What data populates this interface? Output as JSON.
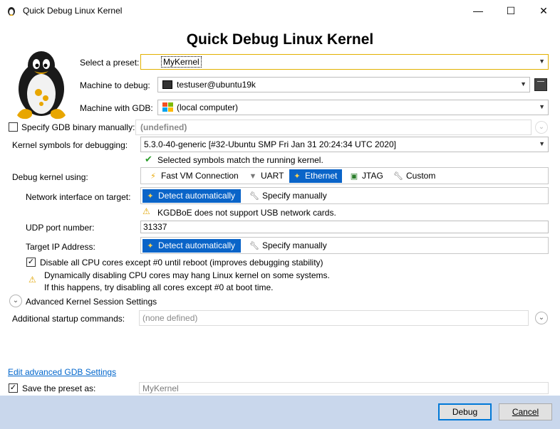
{
  "window": {
    "title": "Quick Debug Linux Kernel",
    "minimize": "—",
    "maximize": "☐",
    "close": "✕"
  },
  "heading": "Quick Debug Linux Kernel",
  "preset": {
    "label": "Select a preset:",
    "value": "MyKernel"
  },
  "machine": {
    "label": "Machine to debug:",
    "value": "testuser@ubuntu19k"
  },
  "gdb_machine": {
    "label": "Machine with GDB:",
    "value": "(local computer)"
  },
  "gdb_binary": {
    "label": "Specify GDB binary manually:",
    "value": "(undefined)",
    "checked": false
  },
  "symbols": {
    "label": "Kernel symbols for debugging:",
    "value": "5.3.0-40-generic [#32-Ubuntu SMP Fri Jan 31 20:24:34 UTC 2020]",
    "status": "Selected symbols match the running kernel."
  },
  "debug_using": {
    "label": "Debug kernel using:",
    "options": [
      "Fast VM Connection",
      "UART",
      "Ethernet",
      "JTAG",
      "Custom"
    ],
    "selected": "Ethernet"
  },
  "network": {
    "label": "Network interface on target:",
    "options": [
      "Detect automatically",
      "Specify manually"
    ],
    "warning": "KGDBoE does not support USB network cards."
  },
  "udp": {
    "label": "UDP port number:",
    "value": "31337"
  },
  "target_ip": {
    "label": "Target IP Address:",
    "options": [
      "Detect automatically",
      "Specify manually"
    ]
  },
  "disable_cores": {
    "label": "Disable all CPU cores except #0 until reboot (improves debugging stability)",
    "checked": true,
    "warning_line1": "Dynamically disabling CPU cores may hang Linux kernel on some systems.",
    "warning_line2": "If this happens, try disabling all cores except #0 at boot time."
  },
  "advanced": {
    "label": "Advanced Kernel Session Settings"
  },
  "startup": {
    "label": "Additional startup commands:",
    "value": "(none defined)"
  },
  "edit_link": "Edit advanced GDB Settings",
  "save_preset": {
    "label": "Save the preset as:",
    "value": "MyKernel",
    "checked": true
  },
  "buttons": {
    "debug": "Debug",
    "cancel": "Cancel"
  },
  "colors": {
    "accent": "#0a64c8",
    "footer": "#c9d7ec",
    "link": "#0066cc"
  }
}
